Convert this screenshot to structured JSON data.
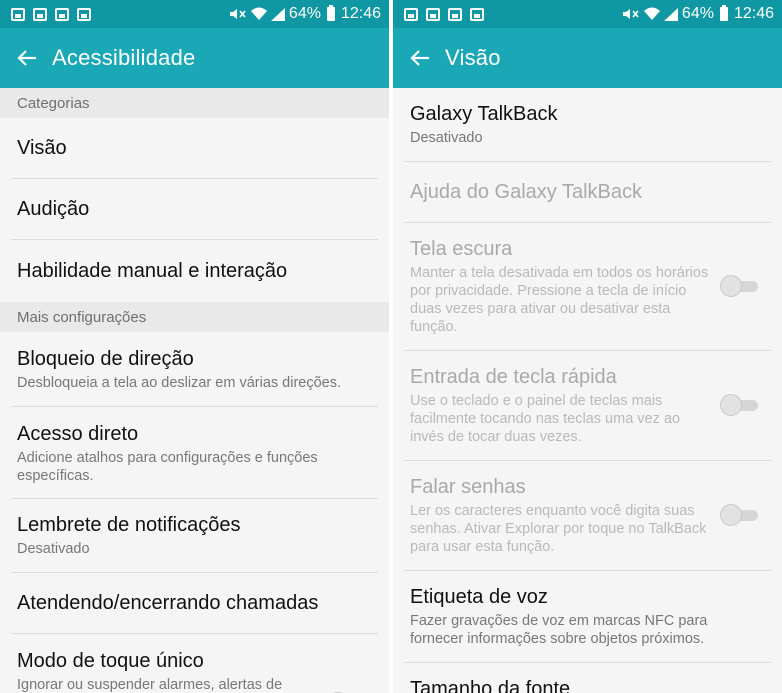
{
  "status_bar": {
    "battery_percent": "64%",
    "time": "12:46",
    "notification_icons": [
      "photo-icon",
      "gallery-icon",
      "briefcase-icon",
      "briefcase-icon"
    ],
    "system_icons": [
      "mute-icon",
      "wifi-icon",
      "signal-icon",
      "battery-icon"
    ]
  },
  "left": {
    "title": "Acessibilidade",
    "categories_header": "Categorias",
    "categories": [
      {
        "title": "Visão"
      },
      {
        "title": "Audição"
      },
      {
        "title": "Habilidade manual e interação"
      }
    ],
    "more_header": "Mais configurações",
    "more": [
      {
        "title": "Bloqueio de direção",
        "subtitle": "Desbloqueia a tela ao deslizar em várias direções."
      },
      {
        "title": "Acesso direto",
        "subtitle": "Adicione atalhos para configurações e funções específicas."
      },
      {
        "title": "Lembrete de notificações",
        "subtitle": "Desativado"
      },
      {
        "title": "Atendendo/encerrando chamadas"
      },
      {
        "title": "Modo de toque único",
        "subtitle": "Ignorar ou suspender alarmes, alertas de"
      }
    ]
  },
  "right": {
    "title": "Visão",
    "items": [
      {
        "title": "Galaxy TalkBack",
        "subtitle": "Desativado",
        "enabled": true
      },
      {
        "title": "Ajuda do Galaxy TalkBack",
        "enabled": false
      },
      {
        "title": "Tela escura",
        "subtitle": "Manter a tela desativada em todos os horários por privacidade. Pressione a tecla de início duas vezes para ativar ou desativar esta função.",
        "enabled": false,
        "toggle": "off"
      },
      {
        "title": "Entrada de tecla rápida",
        "subtitle": "Use o teclado e o painel de teclas mais facilmente tocando nas teclas uma vez ao invés de tocar duas vezes.",
        "enabled": false,
        "toggle": "off"
      },
      {
        "title": "Falar senhas",
        "subtitle": "Ler os caracteres enquanto você digita suas senhas. Ativar Explorar por toque no TalkBack para usar esta função.",
        "enabled": false,
        "toggle": "off"
      },
      {
        "title": "Etiqueta de voz",
        "subtitle": "Fazer gravações de voz em marcas NFC para fornecer informações sobre objetos próximos.",
        "enabled": true
      },
      {
        "title": "Tamanho da fonte",
        "enabled": true
      }
    ]
  },
  "colors": {
    "status_bar": "#0f97a4",
    "app_bar": "#1aa7b6",
    "background": "#f5f5f5",
    "section_header": "#e9e9e9"
  }
}
